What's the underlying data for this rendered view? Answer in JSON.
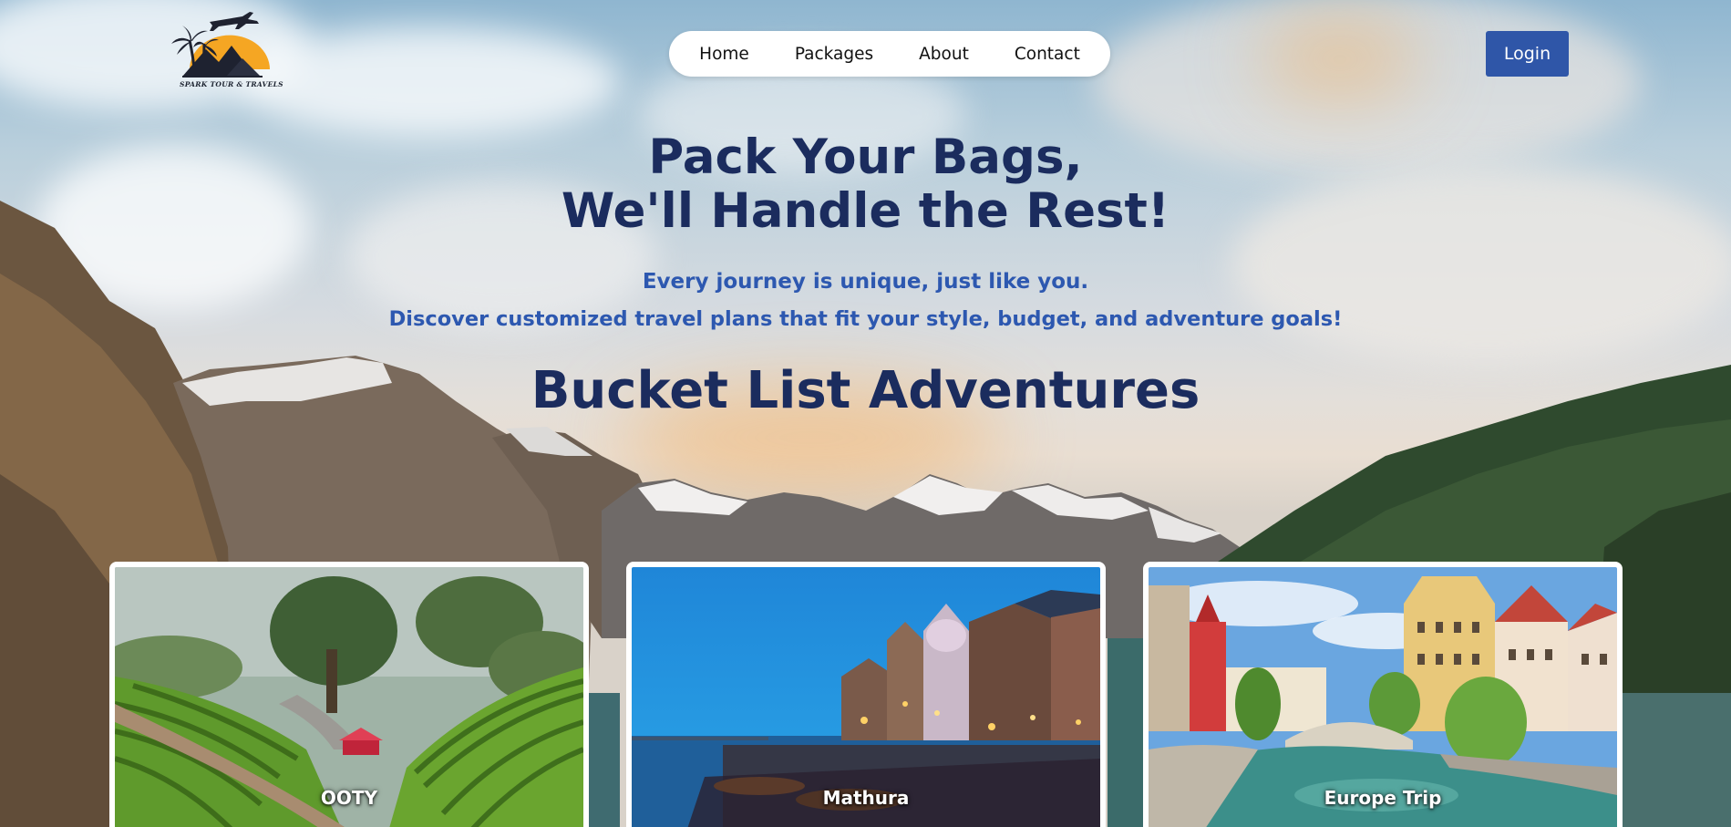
{
  "brand": {
    "name": "SPARK TOUR & TRAVELS",
    "logo_icon": "plane-palm-sunset-logo"
  },
  "nav": {
    "items": [
      {
        "label": "Home"
      },
      {
        "label": "Packages"
      },
      {
        "label": "About"
      },
      {
        "label": "Contact"
      }
    ]
  },
  "header": {
    "login_label": "Login"
  },
  "hero": {
    "title_line1": "Pack Your Bags,",
    "title_line2": "We'll Handle the Rest!",
    "subtitle_line1": "Every journey is unique, just like you.",
    "subtitle_line2": "Discover customized travel plans that fit your style, budget, and adventure goals!"
  },
  "bucket_list": {
    "title": "Bucket List Adventures",
    "cards": [
      {
        "label": "OOTY",
        "image": "tea-plantation-hills"
      },
      {
        "label": "Mathura",
        "image": "river-ghats-evening"
      },
      {
        "label": "Europe Trip",
        "image": "european-canal-town"
      }
    ]
  },
  "colors": {
    "heading": "#1b2c5e",
    "subheading": "#2d58b0",
    "login_button": "#2f56a8",
    "nav_background": "#ffffff"
  }
}
